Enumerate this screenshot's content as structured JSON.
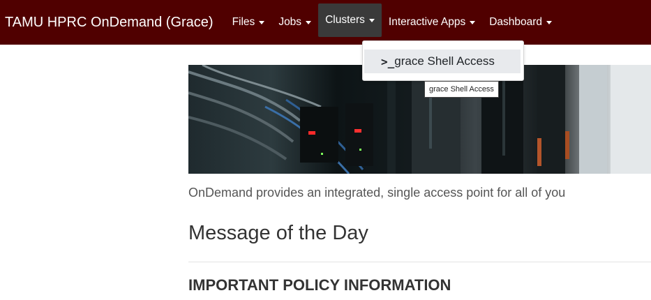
{
  "navbar": {
    "brand": "TAMU HPRC OnDemand (Grace)",
    "items": [
      {
        "label": "Files"
      },
      {
        "label": "Jobs"
      },
      {
        "label": "Clusters"
      },
      {
        "label": "Interactive Apps"
      },
      {
        "label": "Dashboard"
      }
    ],
    "active": "Clusters",
    "colors": {
      "background": "#500000",
      "active": "#3a3a3a"
    }
  },
  "dropdown": {
    "items": [
      {
        "icon": "terminal-prompt-icon",
        "prefix": ">_",
        "label": "grace Shell Access"
      }
    ]
  },
  "tooltip": {
    "text": "grace Shell Access"
  },
  "main": {
    "intro": "OnDemand provides an integrated, single access point for all of you",
    "motd_title": "Message of the Day",
    "policy_heading": "IMPORTANT POLICY INFORMATION"
  }
}
